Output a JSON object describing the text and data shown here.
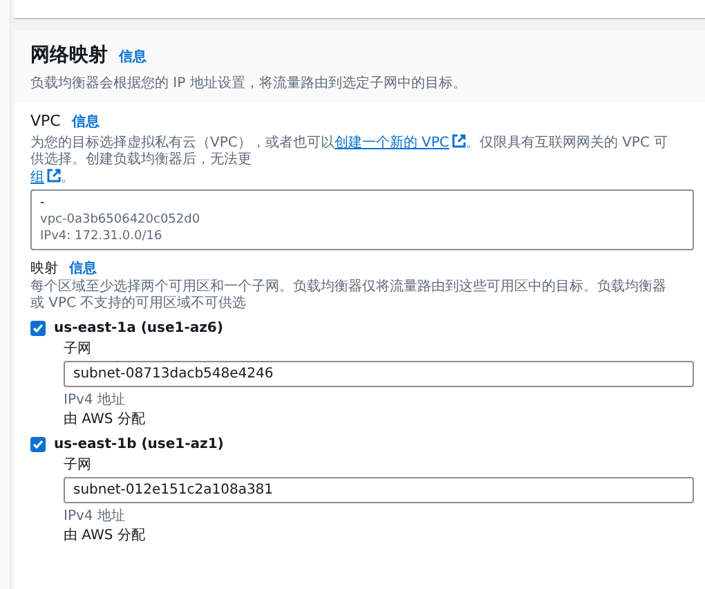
{
  "section": {
    "title": "网络映射",
    "info": "信息",
    "description": "负载均衡器会根据您的 IP 地址设置，将流量路由到选定子网中的目标。"
  },
  "vpc": {
    "label": "VPC",
    "info": "信息",
    "description_before": "为您的目标选择虚拟私有云（VPC），或者也可以",
    "link": "创建一个新的 VPC",
    "description_after": "。仅限具有互联网网关的 VPC 可供选择。创建负载均衡器后，无法更",
    "link2": "组",
    "link2_after": "。",
    "selection": {
      "name": "-",
      "id": "vpc-0a3b6506420c052d0",
      "cidr": "IPv4: 172.31.0.0/16"
    }
  },
  "mappings": {
    "label": "映射",
    "info": "信息",
    "description": "每个区域至少选择两个可用区和一个子网。负载均衡器仅将流量路由到这些可用区中的目标。负载均衡器或 VPC 不支持的可用区域不可供选"
  },
  "zones": [
    {
      "name": "us-east-1a (use1-az6)",
      "checked": true,
      "subnet_label": "子网",
      "subnet": "subnet-08713dacb548e4246",
      "ipv4_label": "IPv4 地址",
      "ipv4_value": "由 AWS 分配"
    },
    {
      "name": "us-east-1b (use1-az1)",
      "checked": true,
      "subnet_label": "子网",
      "subnet": "subnet-012e151c2a108a381",
      "ipv4_label": "IPv4 地址",
      "ipv4_value": "由 AWS 分配"
    }
  ]
}
